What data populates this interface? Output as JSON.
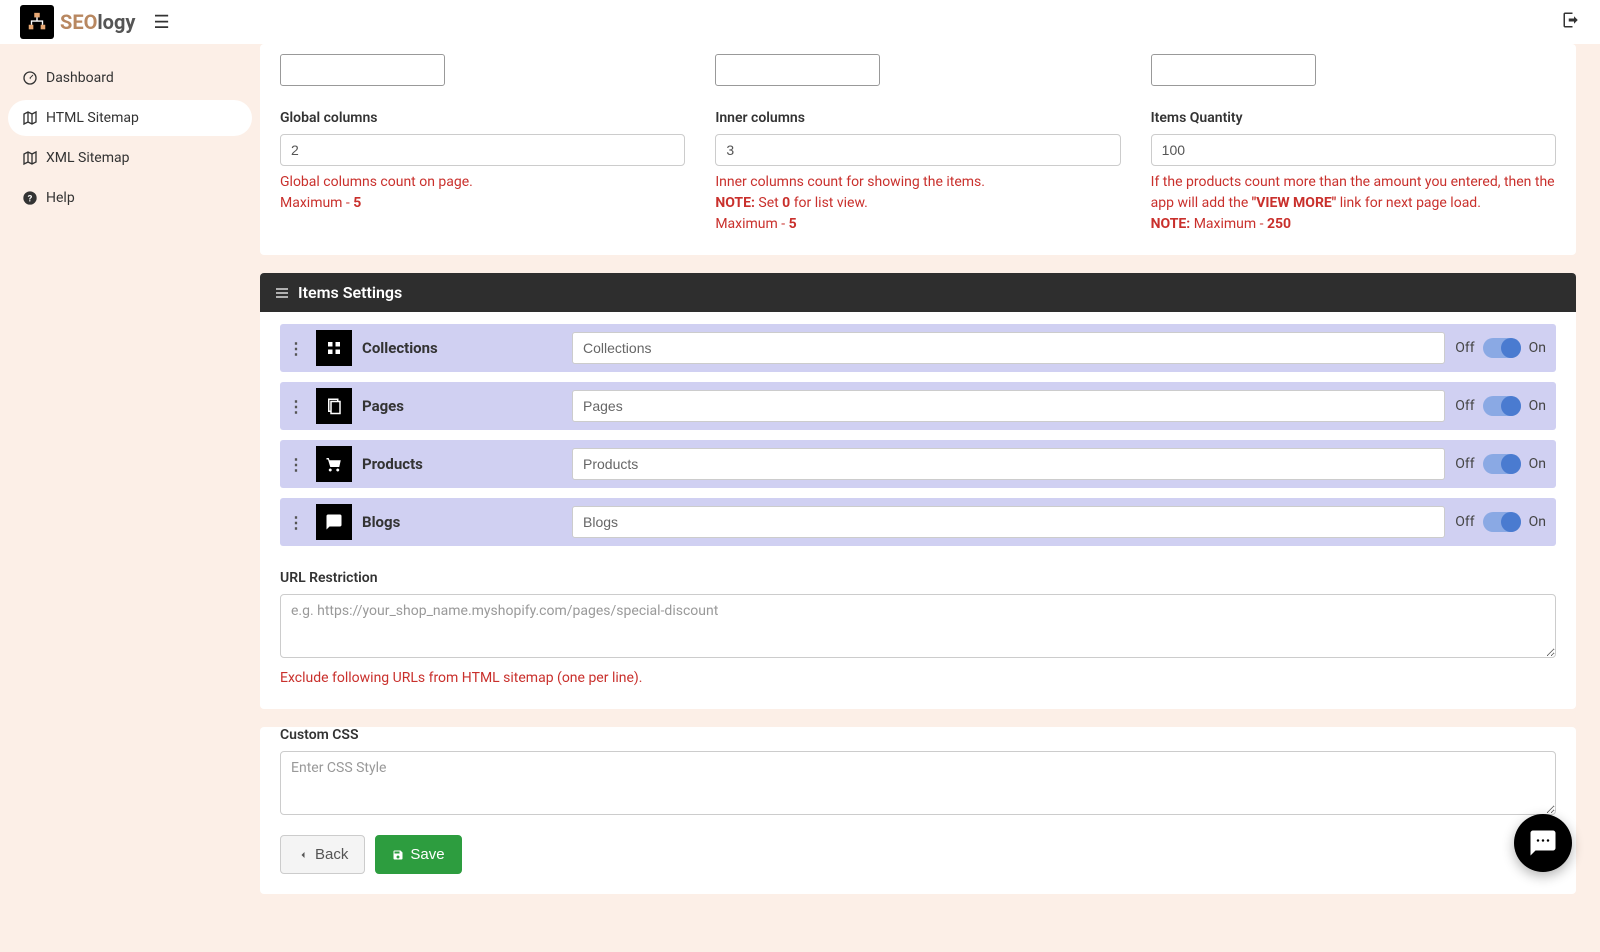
{
  "brand": {
    "name1": "SEO",
    "name2": "logy"
  },
  "nav": {
    "dashboard": "Dashboard",
    "html_sitemap": "HTML Sitemap",
    "xml_sitemap": "XML Sitemap",
    "help": "Help"
  },
  "columns": {
    "global": {
      "label": "Global columns",
      "value": "2",
      "help1": "Global columns count on page.",
      "help2a": "Maximum - ",
      "help2b": "5"
    },
    "inner": {
      "label": "Inner columns",
      "value": "3",
      "help1": "Inner columns count for showing the items.",
      "note_label": "NOTE:",
      "note_text1": " Set ",
      "note_bold": "0",
      "note_text2": " for list view.",
      "max_a": "Maximum - ",
      "max_b": "5"
    },
    "quantity": {
      "label": "Items Quantity",
      "value": "100",
      "help1": "If the products count more than the amount you entered, then the app will add the ",
      "help1b": "\"VIEW MORE\"",
      "help1c": " link for next page load.",
      "note_label": "NOTE:",
      "max_a": " Maximum - ",
      "max_b": "250"
    }
  },
  "items_settings": {
    "header": "Items Settings",
    "off": "Off",
    "on": "On",
    "rows": [
      {
        "name": "Collections",
        "value": "Collections"
      },
      {
        "name": "Pages",
        "value": "Pages"
      },
      {
        "name": "Products",
        "value": "Products"
      },
      {
        "name": "Blogs",
        "value": "Blogs"
      }
    ]
  },
  "url_restriction": {
    "label": "URL Restriction",
    "placeholder": "e.g. https://your_shop_name.myshopify.com/pages/special-discount",
    "help": "Exclude following URLs from HTML sitemap (one per line)."
  },
  "custom_css": {
    "label": "Custom CSS",
    "placeholder": "Enter CSS Style"
  },
  "buttons": {
    "back": "Back",
    "save": "Save"
  }
}
